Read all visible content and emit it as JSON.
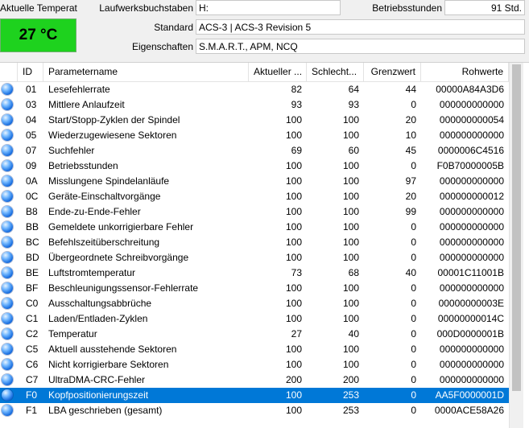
{
  "temperature": {
    "label": "Aktuelle Temperat",
    "value": "27 °C",
    "color": "#1ed21e"
  },
  "info": {
    "drive_letter_label": "Laufwerksbuchstaben",
    "drive_letter_value": "H:",
    "hours_label": "Betriebsstunden",
    "hours_value": "91 Std.",
    "standard_label": "Standard",
    "standard_value": "ACS-3 | ACS-3 Revision 5",
    "features_label": "Eigenschaften",
    "features_value": "S.M.A.R.T., APM, NCQ"
  },
  "table": {
    "columns": [
      "ID",
      "Parametername",
      "Aktueller ...",
      "Schlecht...",
      "Grenzwert",
      "Rohwerte"
    ],
    "selected_color": "#0078d7",
    "rows": [
      {
        "id": "01",
        "name": "Lesefehlerrate",
        "current": "82",
        "worst": "64",
        "threshold": "44",
        "raw": "00000A84A3D6"
      },
      {
        "id": "03",
        "name": "Mittlere Anlaufzeit",
        "current": "93",
        "worst": "93",
        "threshold": "0",
        "raw": "000000000000"
      },
      {
        "id": "04",
        "name": "Start/Stopp-Zyklen der Spindel",
        "current": "100",
        "worst": "100",
        "threshold": "20",
        "raw": "000000000054"
      },
      {
        "id": "05",
        "name": "Wiederzugewiesene Sektoren",
        "current": "100",
        "worst": "100",
        "threshold": "10",
        "raw": "000000000000"
      },
      {
        "id": "07",
        "name": "Suchfehler",
        "current": "69",
        "worst": "60",
        "threshold": "45",
        "raw": "0000006C4516"
      },
      {
        "id": "09",
        "name": "Betriebsstunden",
        "current": "100",
        "worst": "100",
        "threshold": "0",
        "raw": "F0B70000005B"
      },
      {
        "id": "0A",
        "name": "Misslungene Spindelanläufe",
        "current": "100",
        "worst": "100",
        "threshold": "97",
        "raw": "000000000000"
      },
      {
        "id": "0C",
        "name": "Geräte-Einschaltvorgänge",
        "current": "100",
        "worst": "100",
        "threshold": "20",
        "raw": "000000000012"
      },
      {
        "id": "B8",
        "name": "Ende-zu-Ende-Fehler",
        "current": "100",
        "worst": "100",
        "threshold": "99",
        "raw": "000000000000"
      },
      {
        "id": "BB",
        "name": "Gemeldete unkorrigierbare Fehler",
        "current": "100",
        "worst": "100",
        "threshold": "0",
        "raw": "000000000000"
      },
      {
        "id": "BC",
        "name": "Befehlszeitüberschreitung",
        "current": "100",
        "worst": "100",
        "threshold": "0",
        "raw": "000000000000"
      },
      {
        "id": "BD",
        "name": "Übergeordnete Schreibvorgänge",
        "current": "100",
        "worst": "100",
        "threshold": "0",
        "raw": "000000000000"
      },
      {
        "id": "BE",
        "name": "Luftstromtemperatur",
        "current": "73",
        "worst": "68",
        "threshold": "40",
        "raw": "00001C11001B"
      },
      {
        "id": "BF",
        "name": "Beschleunigungssensor-Fehlerrate",
        "current": "100",
        "worst": "100",
        "threshold": "0",
        "raw": "000000000000"
      },
      {
        "id": "C0",
        "name": "Ausschaltungsabbrüche",
        "current": "100",
        "worst": "100",
        "threshold": "0",
        "raw": "00000000003E"
      },
      {
        "id": "C1",
        "name": "Laden/Entladen-Zyklen",
        "current": "100",
        "worst": "100",
        "threshold": "0",
        "raw": "00000000014C"
      },
      {
        "id": "C2",
        "name": "Temperatur",
        "current": "27",
        "worst": "40",
        "threshold": "0",
        "raw": "000D0000001B"
      },
      {
        "id": "C5",
        "name": "Aktuell ausstehende Sektoren",
        "current": "100",
        "worst": "100",
        "threshold": "0",
        "raw": "000000000000"
      },
      {
        "id": "C6",
        "name": "Nicht korrigierbare Sektoren",
        "current": "100",
        "worst": "100",
        "threshold": "0",
        "raw": "000000000000"
      },
      {
        "id": "C7",
        "name": "UltraDMA-CRC-Fehler",
        "current": "200",
        "worst": "200",
        "threshold": "0",
        "raw": "000000000000"
      },
      {
        "id": "F0",
        "name": "Kopfpositionierungszeit",
        "current": "100",
        "worst": "253",
        "threshold": "0",
        "raw": "AA5F0000001D",
        "selected": true
      },
      {
        "id": "F1",
        "name": "LBA geschrieben (gesamt)",
        "current": "100",
        "worst": "253",
        "threshold": "0",
        "raw": "0000ACE58A26"
      }
    ]
  }
}
